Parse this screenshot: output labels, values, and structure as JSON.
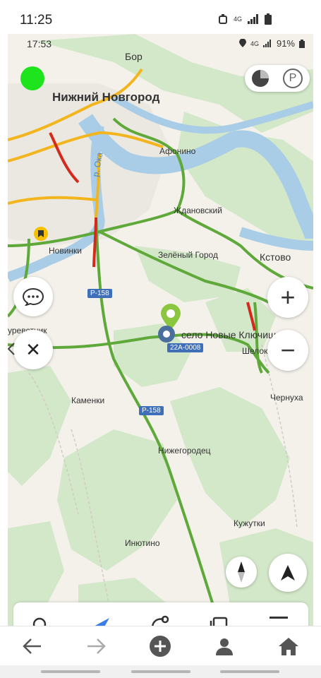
{
  "status_bar": {
    "time": "11:25",
    "network": "4G"
  },
  "app_status": {
    "time": "17:53",
    "network": "4G",
    "battery": "91%"
  },
  "map": {
    "places": {
      "bor": "Бор",
      "nizhny": "Нижний Новгород",
      "afonino": "Афонино",
      "zhdanovsky": "Ждановский",
      "oka": "р. Ока",
      "zeleny_gorod": "Зелёный Город",
      "kstovo": "Кстово",
      "novinki": "Новинки",
      "selo": "село Новые Ключищи",
      "shelokovo": "Шелоков",
      "chernukha": "Чернуха",
      "kamenki": "Каменки",
      "nizhegorodets": "Нижегородец",
      "kuzhutki": "Кужутки",
      "inyutino": "Инютино",
      "kurevstnik": "уревстник"
    },
    "roads": {
      "r158_a": "Р-158",
      "r158_b": "Р-158",
      "road_22a": "22А-0008"
    },
    "colors": {
      "route_green": "#5fa93b",
      "traffic_red": "#d42a1c",
      "traffic_yellow": "#f2b51d",
      "water": "#a9cde6",
      "forest": "#d3e8c9",
      "pin_green": "#8cc63f",
      "pin_blue": "#4b6f9c"
    }
  },
  "controls": {
    "zoom_in": "+",
    "zoom_out": "−",
    "parking": "P",
    "close": "✕"
  }
}
